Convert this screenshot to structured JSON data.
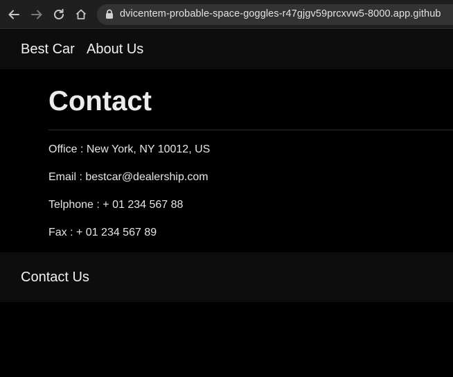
{
  "browser": {
    "url": "dvicentem-probable-space-goggles-r47gjgv59prcxvw5-8000.app.github",
    "back_icon": "back-arrow-icon",
    "forward_icon": "forward-arrow-icon",
    "reload_icon": "reload-icon",
    "home_icon": "home-icon",
    "lock_icon": "lock-icon"
  },
  "nav": {
    "brand": "Best Car",
    "about": "About Us"
  },
  "main": {
    "title": "Contact",
    "office": "Office : New York, NY 10012, US",
    "email": "Email : bestcar@dealership.com",
    "telephone": "Telphone : + 01 234 567 88",
    "fax": "Fax : + 01 234 567 89"
  },
  "footer": {
    "contact_link": "Contact Us"
  },
  "colors": {
    "page_background": "#000000",
    "bar_background": "#0d0d0d",
    "browser_chrome": "#1f1f1f",
    "text": "#e8e8e8"
  }
}
